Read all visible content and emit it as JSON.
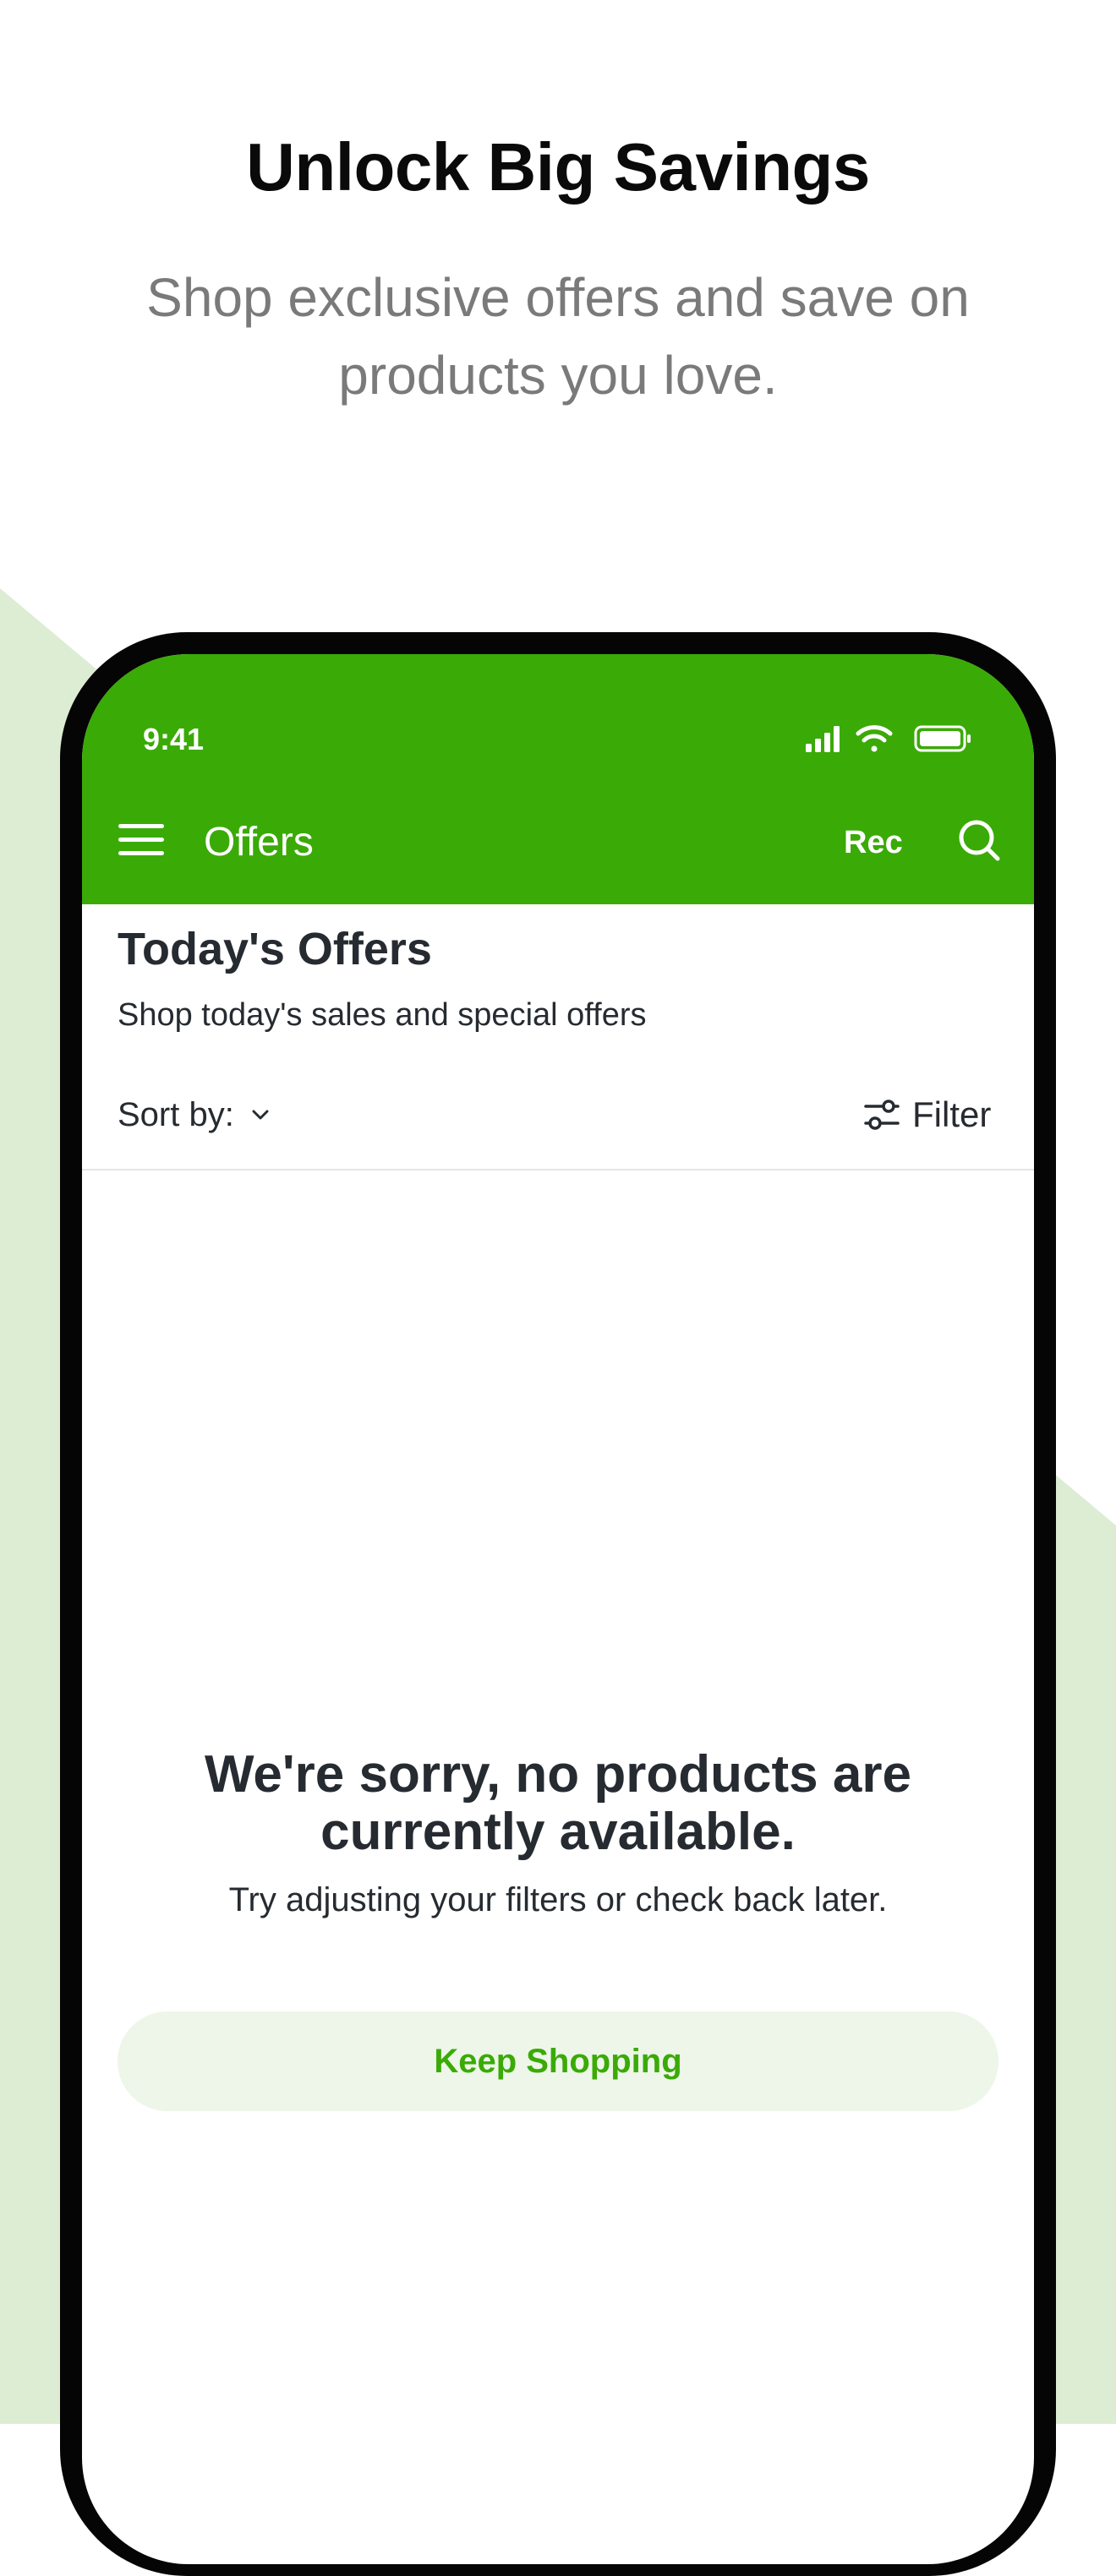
{
  "promo": {
    "title": "Unlock Big Savings",
    "subtitle": "Shop exclusive offers and save on products you love."
  },
  "status_bar": {
    "time": "9:41",
    "icons": [
      "cellular-signal-icon",
      "wifi-icon",
      "battery-icon"
    ]
  },
  "nav": {
    "menu_icon": "hamburger-menu-icon",
    "title": "Offers",
    "rec_label": "Rec",
    "search_icon": "search-icon"
  },
  "page": {
    "heading": "Today's Offers",
    "subheading": "Shop today's sales and special offers"
  },
  "toolbar": {
    "sort_label": "Sort by:",
    "sort_icon": "chevron-down-icon",
    "filter_label": "Filter",
    "filter_icon": "filter-sliders-icon"
  },
  "empty_state": {
    "title": "We're sorry, no products are currently available.",
    "message": "Try adjusting your filters or check back later.",
    "button_label": "Keep Shopping"
  },
  "colors": {
    "brand_green": "#3aaa07",
    "light_green_background": "#dcedd3",
    "button_background": "#edf6e8",
    "text_dark": "#262b31",
    "text_muted": "#7a7a7a"
  }
}
